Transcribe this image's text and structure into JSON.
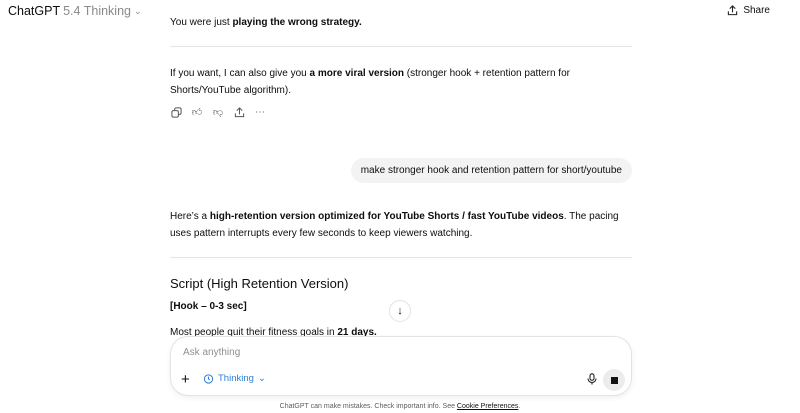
{
  "header": {
    "brand": "ChatGPT",
    "model": "5.4 Thinking",
    "share_label": "Share"
  },
  "messages": {
    "m1": {
      "pre": "You were just ",
      "bold": "playing the wrong strategy."
    },
    "m2": {
      "pre": "If you want, I can also give you ",
      "bold": "a more viral version",
      "post": " (stronger hook + retention pattern for Shorts/YouTube algorithm)."
    },
    "user": "make stronger hook and retention pattern for short/youtube",
    "m3": {
      "pre": "Here’s a ",
      "bold": "high-retention version optimized for YouTube Shorts / fast YouTube videos",
      "post": ". The pacing uses pattern interrupts every few seconds to keep viewers watching."
    },
    "heading": "Script (High Retention Version)",
    "hook": "[Hook – 0-3 sec]",
    "m4": {
      "pre": "Most people quit their fitness goals in ",
      "bold": "21 days."
    }
  },
  "composer": {
    "placeholder": "Ask anything",
    "mode": "Thinking"
  },
  "footer": {
    "text": "ChatGPT can make mistakes. Check important info. See ",
    "link": "Cookie Preferences",
    "end": "."
  }
}
